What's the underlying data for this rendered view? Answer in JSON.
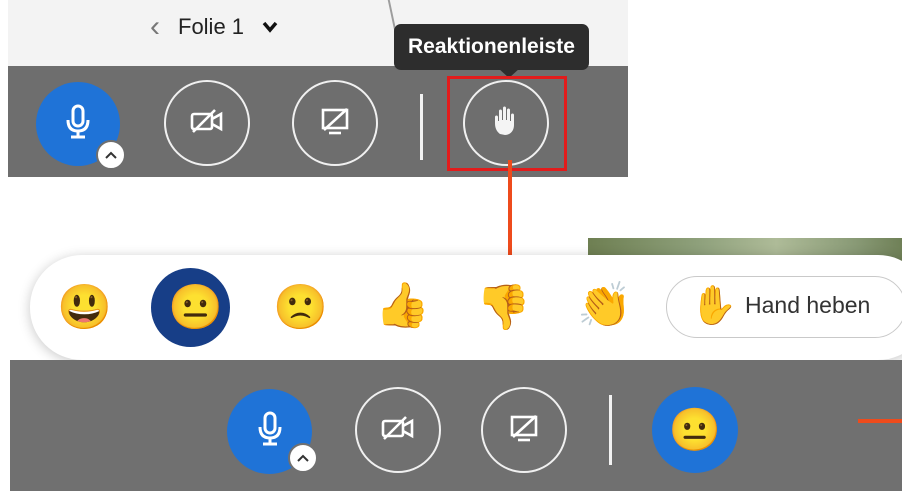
{
  "slide_nav": {
    "label": "Folie 1"
  },
  "tooltip": {
    "text": "Reaktionenleiste"
  },
  "toolbar_top": {
    "buttons": [
      {
        "name": "microphone",
        "icon": "microphone-icon"
      },
      {
        "name": "camera-off",
        "icon": "camera-off-icon"
      },
      {
        "name": "screen-share-off",
        "icon": "screen-share-off-icon"
      },
      {
        "name": "reactions",
        "icon": "raise-hand-icon"
      }
    ]
  },
  "reactions": {
    "items": [
      {
        "name": "grinning",
        "glyph": "😃"
      },
      {
        "name": "neutral",
        "glyph": "😐",
        "selected": true
      },
      {
        "name": "slightly-frowning",
        "glyph": "🙁"
      },
      {
        "name": "thumbs-up",
        "glyph": "👍"
      },
      {
        "name": "thumbs-down",
        "glyph": "👎"
      },
      {
        "name": "clapping",
        "glyph": "👏"
      }
    ],
    "hand_button": {
      "glyph": "✋",
      "label": "Hand heben"
    }
  },
  "toolbar_bottom": {
    "current_reaction_glyph": "😐"
  },
  "colors": {
    "accent_blue": "#1f73d7",
    "selected_reaction_bg": "#173e87",
    "toolbar_gray": "#6e6e6e",
    "highlight_red": "#e21b1b",
    "arrow_orange": "#ee4b1c"
  }
}
